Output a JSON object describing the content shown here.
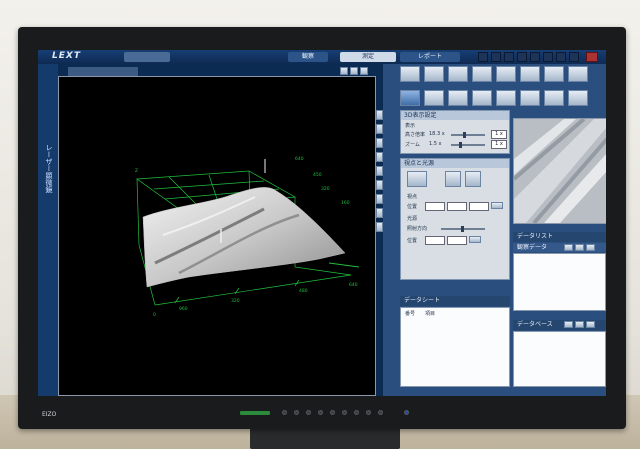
{
  "app": {
    "logo": "LEXT"
  },
  "modes": [
    {
      "label": ""
    },
    {
      "label": "観察"
    },
    {
      "label": "測定"
    },
    {
      "label": "レポート"
    }
  ],
  "sidebar": {
    "label": "レーザー顕微鏡"
  },
  "viewer": {
    "tab_label": "",
    "axes": {
      "z_top": "640",
      "z_mid": "450",
      "z2": "320",
      "z3": "160",
      "x_mid": "320",
      "x_left": "960",
      "x_end": "640",
      "x_right": "480",
      "origin": "0",
      "z_axis": "Z"
    }
  },
  "display3d": {
    "title": "3D表示設定",
    "section": "表示",
    "row1_label": "高さ倍率",
    "row1_value": "18.3 x",
    "row1_box": "1 x",
    "row2_label": "ズーム",
    "row2_value": "1.5 x",
    "row2_box": "1 x"
  },
  "lighting": {
    "title": "視点と光源",
    "sub_label": "視点",
    "pos_label": "位置",
    "light_label": "光源",
    "light_sub": "照射方向",
    "pos2_label": "位置"
  },
  "datasheet": {
    "title": "データシート",
    "col1": "番号",
    "col2": "項目"
  },
  "datalist": {
    "title": "データリスト",
    "sub": "観察データ",
    "row1": ""
  },
  "database": {
    "title": "データベース",
    "row1": ""
  },
  "colors": {
    "accent": "#2a4f7e",
    "screen": "#0c2b52",
    "grid": "#1fbf3c"
  },
  "bezel": {
    "brand": "EIZO"
  }
}
